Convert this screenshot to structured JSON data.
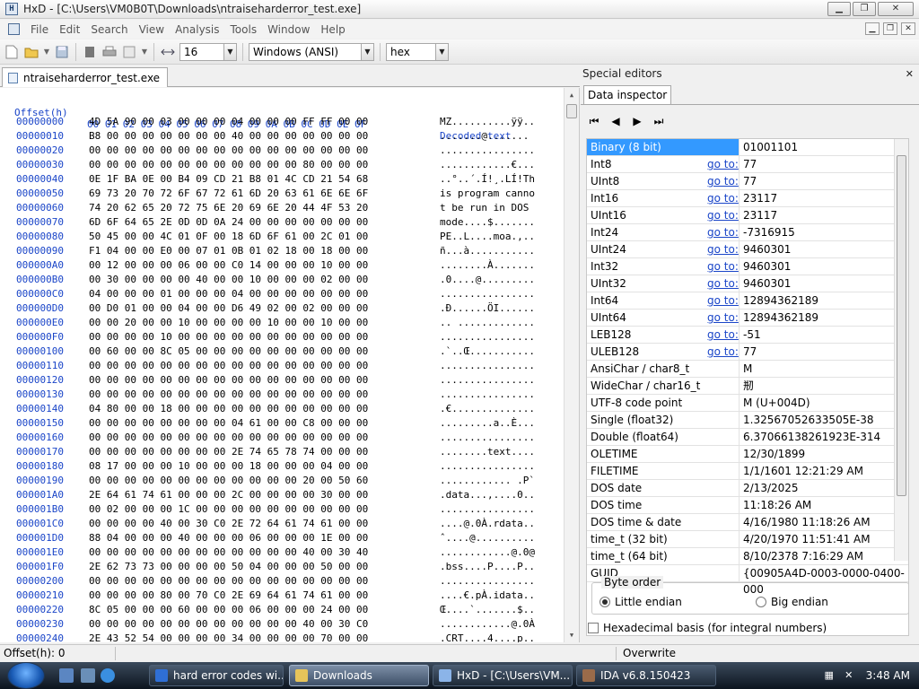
{
  "window": {
    "title": "HxD - [C:\\Users\\VM0B0T\\Downloads\\ntraiseharderror_test.exe]",
    "min": "▁",
    "max": "❐",
    "close": "✕"
  },
  "menu": [
    "File",
    "Edit",
    "Search",
    "View",
    "Analysis",
    "Tools",
    "Window",
    "Help"
  ],
  "toolbar": {
    "bytes_per_row": "16",
    "charset": "Windows (ANSI)",
    "offset_base": "hex"
  },
  "doc_tab": "ntraiseharderror_test.exe",
  "hex": {
    "header_offset": "Offset(h)",
    "header_cols": "00 01 02 03 04 05 06 07 08 09 0A 0B 0C 0D 0E 0F",
    "header_decoded": "Decoded text",
    "rows": [
      {
        "o": "00000000",
        "b": "4D 5A 90 00 03 00 00 00 04 00 00 00 FF FF 00 00",
        "t": "MZ..........ÿÿ.."
      },
      {
        "o": "00000010",
        "b": "B8 00 00 00 00 00 00 00 40 00 00 00 00 00 00 00",
        "t": ".......@......."
      },
      {
        "o": "00000020",
        "b": "00 00 00 00 00 00 00 00 00 00 00 00 00 00 00 00",
        "t": "................"
      },
      {
        "o": "00000030",
        "b": "00 00 00 00 00 00 00 00 00 00 00 00 80 00 00 00",
        "t": "............€..."
      },
      {
        "o": "00000040",
        "b": "0E 1F BA 0E 00 B4 09 CD 21 B8 01 4C CD 21 54 68",
        "t": "..°..´.Í!¸.LÍ!Th"
      },
      {
        "o": "00000050",
        "b": "69 73 20 70 72 6F 67 72 61 6D 20 63 61 6E 6E 6F",
        "t": "is program canno"
      },
      {
        "o": "00000060",
        "b": "74 20 62 65 20 72 75 6E 20 69 6E 20 44 4F 53 20",
        "t": "t be run in DOS "
      },
      {
        "o": "00000070",
        "b": "6D 6F 64 65 2E 0D 0D 0A 24 00 00 00 00 00 00 00",
        "t": "mode....$......."
      },
      {
        "o": "00000080",
        "b": "50 45 00 00 4C 01 0F 00 18 6D 6F 61 00 2C 01 00",
        "t": "PE..L....moa.,.."
      },
      {
        "o": "00000090",
        "b": "F1 04 00 00 E0 00 07 01 0B 01 02 18 00 18 00 00",
        "t": "ñ...à..........."
      },
      {
        "o": "000000A0",
        "b": "00 12 00 00 00 06 00 00 C0 14 00 00 00 10 00 00",
        "t": "........À......."
      },
      {
        "o": "000000B0",
        "b": "00 30 00 00 00 00 40 00 00 10 00 00 00 02 00 00",
        "t": ".0....@........."
      },
      {
        "o": "000000C0",
        "b": "04 00 00 00 01 00 00 00 04 00 00 00 00 00 00 00",
        "t": "................"
      },
      {
        "o": "000000D0",
        "b": "00 D0 01 00 00 04 00 00 D6 49 02 00 02 00 00 00",
        "t": ".Ð......ÖI......"
      },
      {
        "o": "000000E0",
        "b": "00 00 20 00 00 10 00 00 00 00 10 00 00 10 00 00",
        "t": ".. ............."
      },
      {
        "o": "000000F0",
        "b": "00 00 00 00 10 00 00 00 00 00 00 00 00 00 00 00",
        "t": "................"
      },
      {
        "o": "00000100",
        "b": "00 60 00 00 8C 05 00 00 00 00 00 00 00 00 00 00",
        "t": ".`..Œ..........."
      },
      {
        "o": "00000110",
        "b": "00 00 00 00 00 00 00 00 00 00 00 00 00 00 00 00",
        "t": "................"
      },
      {
        "o": "00000120",
        "b": "00 00 00 00 00 00 00 00 00 00 00 00 00 00 00 00",
        "t": "................"
      },
      {
        "o": "00000130",
        "b": "00 00 00 00 00 00 00 00 00 00 00 00 00 00 00 00",
        "t": "................"
      },
      {
        "o": "00000140",
        "b": "04 80 00 00 18 00 00 00 00 00 00 00 00 00 00 00",
        "t": ".€.............."
      },
      {
        "o": "00000150",
        "b": "00 00 00 00 00 00 00 00 04 61 00 00 C8 00 00 00",
        "t": ".........a..È..."
      },
      {
        "o": "00000160",
        "b": "00 00 00 00 00 00 00 00 00 00 00 00 00 00 00 00",
        "t": "................"
      },
      {
        "o": "00000170",
        "b": "00 00 00 00 00 00 00 00 2E 74 65 78 74 00 00 00",
        "t": "........text...."
      },
      {
        "o": "00000180",
        "b": "08 17 00 00 00 10 00 00 00 18 00 00 00 04 00 00",
        "t": "................"
      },
      {
        "o": "00000190",
        "b": "00 00 00 00 00 00 00 00 00 00 00 00 20 00 50 60",
        "t": "............ .P`"
      },
      {
        "o": "000001A0",
        "b": "2E 64 61 74 61 00 00 00 2C 00 00 00 00 30 00 00",
        "t": ".data...,....0.."
      },
      {
        "o": "000001B0",
        "b": "00 02 00 00 00 1C 00 00 00 00 00 00 00 00 00 00",
        "t": "................"
      },
      {
        "o": "000001C0",
        "b": "00 00 00 00 40 00 30 C0 2E 72 64 61 74 61 00 00",
        "t": "....@.0À.rdata.."
      },
      {
        "o": "000001D0",
        "b": "88 04 00 00 00 40 00 00 00 06 00 00 00 1E 00 00",
        "t": "ˆ....@.........."
      },
      {
        "o": "000001E0",
        "b": "00 00 00 00 00 00 00 00 00 00 00 00 40 00 30 40",
        "t": "............@.0@"
      },
      {
        "o": "000001F0",
        "b": "2E 62 73 73 00 00 00 00 50 04 00 00 00 50 00 00",
        "t": ".bss....P....P.."
      },
      {
        "o": "00000200",
        "b": "00 00 00 00 00 00 00 00 00 00 00 00 00 00 00 00",
        "t": "................"
      },
      {
        "o": "00000210",
        "b": "00 00 00 00 80 00 70 C0 2E 69 64 61 74 61 00 00",
        "t": "....€.pÀ.idata.."
      },
      {
        "o": "00000220",
        "b": "8C 05 00 00 00 60 00 00 00 06 00 00 00 24 00 00",
        "t": "Œ....`.......$.."
      },
      {
        "o": "00000230",
        "b": "00 00 00 00 00 00 00 00 00 00 00 00 40 00 30 C0",
        "t": "............@.0À"
      },
      {
        "o": "00000240",
        "b": "2E 43 52 54 00 00 00 00 34 00 00 00 00 70 00 00",
        "t": ".CRT....4....p.."
      }
    ]
  },
  "special_editors": {
    "title": "Special editors",
    "close": "✕",
    "tab": "Data inspector",
    "nav": [
      "⏮",
      "◀",
      "▶",
      "⏭"
    ],
    "goto_label": "go to:",
    "rows": [
      {
        "name": "Binary (8 bit)",
        "value": "01001101",
        "goto": false
      },
      {
        "name": "Int8",
        "value": "77",
        "goto": true
      },
      {
        "name": "UInt8",
        "value": "77",
        "goto": true
      },
      {
        "name": "Int16",
        "value": "23117",
        "goto": true
      },
      {
        "name": "UInt16",
        "value": "23117",
        "goto": true
      },
      {
        "name": "Int24",
        "value": "-7316915",
        "goto": true
      },
      {
        "name": "UInt24",
        "value": "9460301",
        "goto": true
      },
      {
        "name": "Int32",
        "value": "9460301",
        "goto": true
      },
      {
        "name": "UInt32",
        "value": "9460301",
        "goto": true
      },
      {
        "name": "Int64",
        "value": "12894362189",
        "goto": true
      },
      {
        "name": "UInt64",
        "value": "12894362189",
        "goto": true
      },
      {
        "name": "LEB128",
        "value": "-51",
        "goto": true
      },
      {
        "name": "ULEB128",
        "value": "77",
        "goto": true
      },
      {
        "name": "AnsiChar / char8_t",
        "value": "M",
        "goto": false
      },
      {
        "name": "WideChar / char16_t",
        "value": "剏",
        "goto": false
      },
      {
        "name": "UTF-8 code point",
        "value": "M (U+004D)",
        "goto": false
      },
      {
        "name": "Single (float32)",
        "value": "1.32567052633505E-38",
        "goto": false
      },
      {
        "name": "Double (float64)",
        "value": "6.37066138261923E-314",
        "goto": false
      },
      {
        "name": "OLETIME",
        "value": "12/30/1899",
        "goto": false
      },
      {
        "name": "FILETIME",
        "value": "1/1/1601 12:21:29 AM",
        "goto": false
      },
      {
        "name": "DOS date",
        "value": "2/13/2025",
        "goto": false
      },
      {
        "name": "DOS time",
        "value": "11:18:26 AM",
        "goto": false
      },
      {
        "name": "DOS time & date",
        "value": "4/16/1980 11:18:26 AM",
        "goto": false
      },
      {
        "name": "time_t (32 bit)",
        "value": "4/20/1970 11:51:41 AM",
        "goto": false
      },
      {
        "name": "time_t (64 bit)",
        "value": "8/10/2378 7:16:29 AM",
        "goto": false
      },
      {
        "name": "GUID",
        "value": "{00905A4D-0003-0000-0400-000",
        "goto": false
      }
    ],
    "byte_order_label": "Byte order",
    "little_endian": "Little endian",
    "big_endian": "Big endian",
    "hex_basis": "Hexadecimal basis (for integral numbers)"
  },
  "status": {
    "offset": "Offset(h): 0",
    "mode": "Overwrite"
  },
  "taskbar": {
    "tasks": [
      {
        "label": "hard error codes wi...",
        "color": "#2f6fd6"
      },
      {
        "label": "Downloads",
        "color": "#e6c45a"
      },
      {
        "label": "HxD - [C:\\Users\\VM...",
        "color": "#8bb4e8"
      },
      {
        "label": "IDA v6.8.150423",
        "color": "#9a6b4a"
      }
    ],
    "clock": "3:48 AM"
  }
}
